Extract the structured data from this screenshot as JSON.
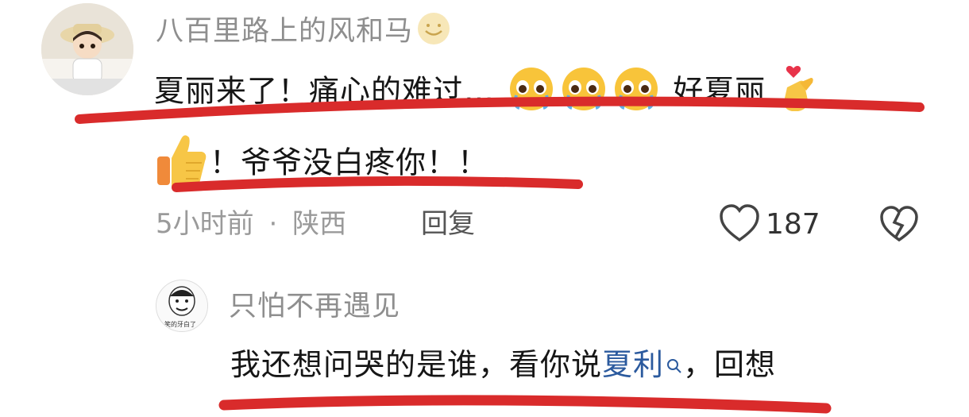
{
  "comment1": {
    "username": "八百里路上的风和马",
    "text_line1": "夏丽来了！痛心的难过…",
    "text_line1b": "好夏丽",
    "text_line2": "！爷爷没白疼你！！",
    "time": "5小时前",
    "separator": "·",
    "location": "陕西",
    "reply_label": "回复",
    "like_count": "187"
  },
  "comment2": {
    "username": "只怕不再遇见",
    "text_prefix": "我还想问哭的是谁，看你说",
    "text_link": "夏利",
    "text_suffix": "，回想",
    "avatar_caption": "笑的牙白了"
  },
  "colors": {
    "underline": "#d92b2b",
    "link": "#2b5a9e",
    "meta": "#9a9a9a"
  },
  "icons": {
    "smile": "smile-emoji-icon",
    "cry": "pleading-cry-emoji-icon",
    "heart_hand": "finger-heart-emoji-icon",
    "thumbs_up": "thumbs-up-emoji-icon",
    "like": "heart-outline-icon",
    "dislike": "broken-heart-icon",
    "search": "search-icon"
  }
}
